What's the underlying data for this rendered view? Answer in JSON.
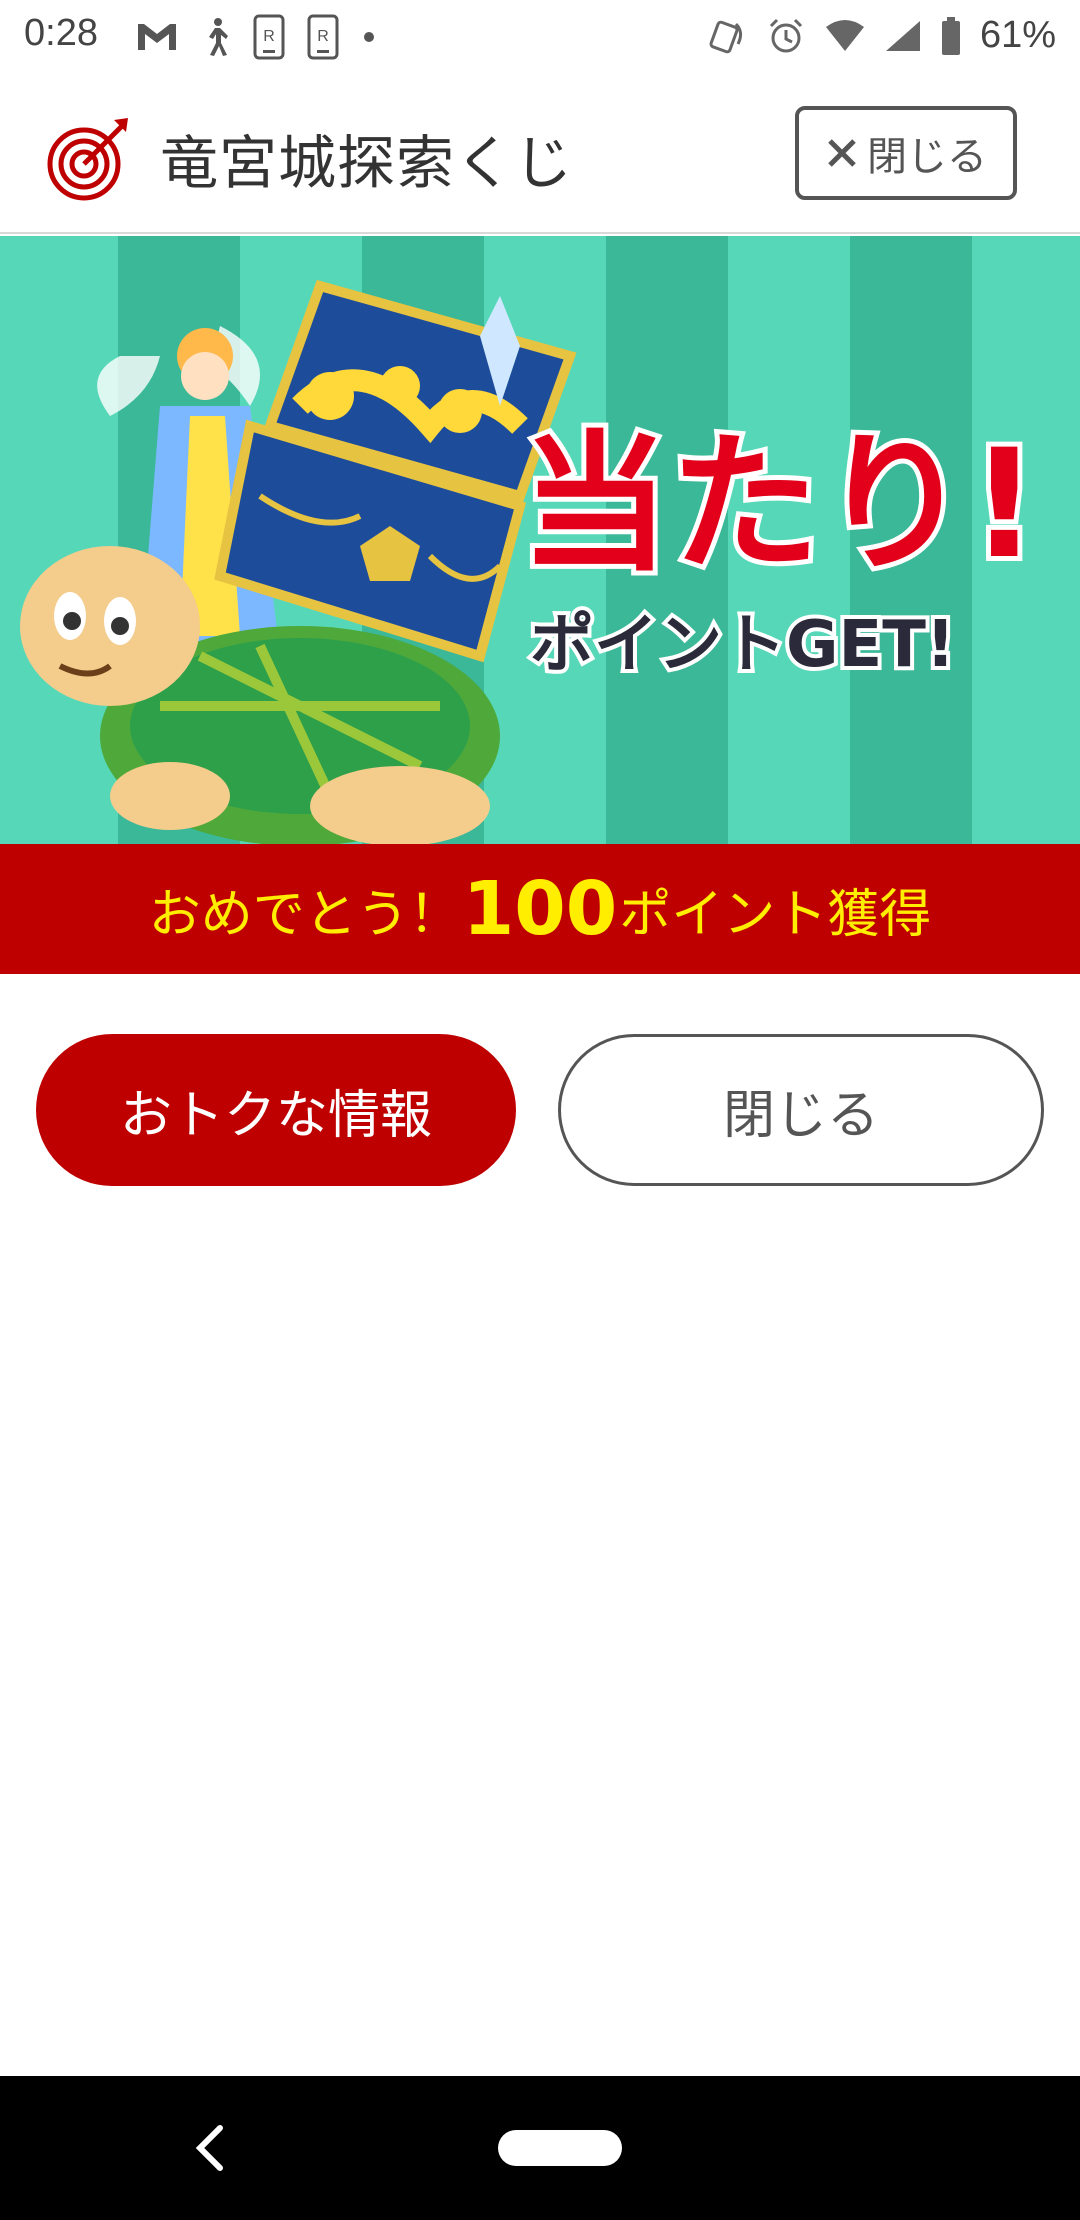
{
  "status_bar": {
    "time": "0:28",
    "battery": "61%",
    "icons_left": [
      "gmail-icon",
      "walk-icon",
      "rakuten-phone-icon",
      "rakuten-phone-icon",
      "dot-icon"
    ],
    "icons_right": [
      "nfc-icon",
      "alarm-icon",
      "wifi-icon",
      "signal-icon",
      "battery-icon"
    ]
  },
  "header": {
    "title": "竜宮城探索くじ",
    "close_label": "閉じる",
    "logo_icon": "target-arrow-icon",
    "accent": "#bf0000"
  },
  "banner": {
    "headline": "当たり!",
    "subline": "ポイントGET!",
    "bg_colors": [
      "#56d8b8",
      "#3ab898"
    ]
  },
  "congrats": {
    "pre": "おめでとう！",
    "points": "100",
    "post": "ポイント獲得",
    "text_color": "#ffee00",
    "bg_color": "#bf0000"
  },
  "buttons": {
    "deals_label": "おトクな情報",
    "close_label": "閉じる"
  },
  "nav": {
    "back_icon": "back-chevron-icon",
    "home_icon": "home-pill-icon"
  }
}
